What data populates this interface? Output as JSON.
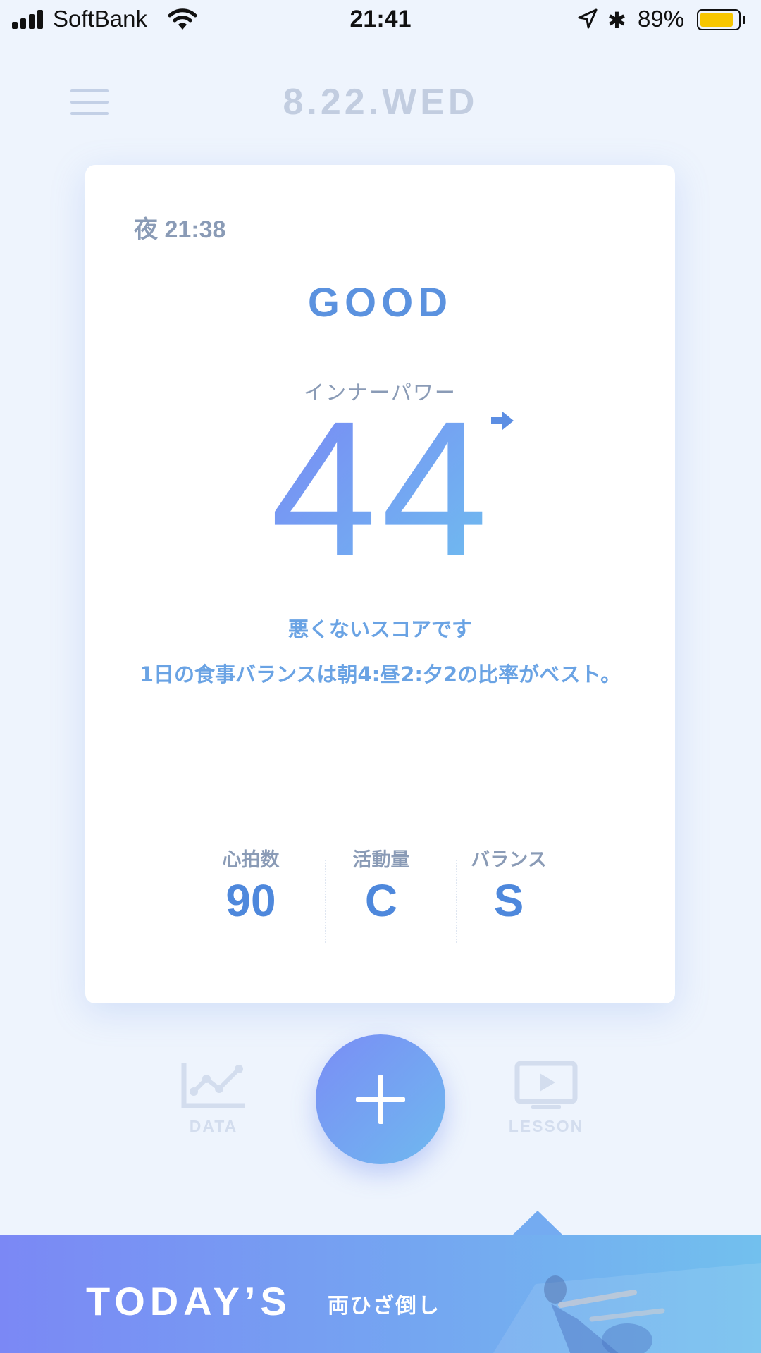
{
  "status_bar": {
    "carrier": "SoftBank",
    "time": "21:41",
    "battery_percent": "89%",
    "battery_level": 0.89,
    "battery_color": "#f7c600"
  },
  "header": {
    "menu_icon": "hamburger-menu-icon",
    "date": "8.22.WED"
  },
  "card": {
    "time": "夜 21:38",
    "status": "GOOD",
    "power_label": "インナーパワー",
    "score": "44",
    "trend_icon": "arrow-right-icon",
    "message": "悪くないスコアです",
    "tip": "1日の食事バランスは朝4:昼2:夕2の比率がベスト。",
    "stats": [
      {
        "label": "心拍数",
        "value": "90"
      },
      {
        "label": "活動量",
        "value": "C"
      },
      {
        "label": "バランス",
        "value": "S"
      }
    ]
  },
  "nav": {
    "data_label": "DATA",
    "data_icon": "line-chart-icon",
    "add_icon": "plus-icon",
    "lesson_label": "LESSON",
    "lesson_icon": "video-play-icon"
  },
  "banner": {
    "title": "TODAY’S",
    "subtitle": "両ひざ倒し"
  },
  "colors": {
    "accent": "#5b92df",
    "background": "#eef4fd",
    "gradient_start": "#7b88f5",
    "gradient_end": "#72c0ee"
  }
}
